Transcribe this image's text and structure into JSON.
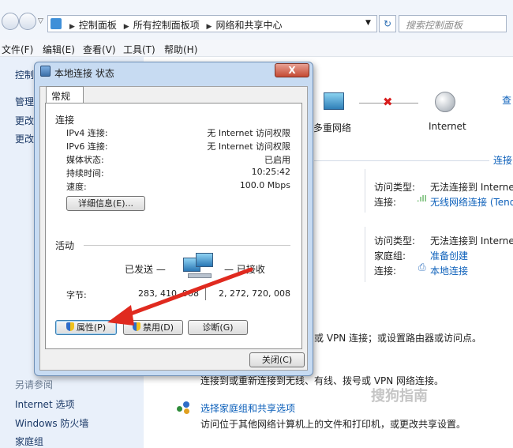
{
  "address": {
    "crumbs": [
      "控制面板",
      "所有控制面板项",
      "网络和共享中心"
    ],
    "search_placeholder": "搜索控制面板"
  },
  "menu": [
    "文件(F)",
    "编辑(E)",
    "查看(V)",
    "工具(T)",
    "帮助(H)"
  ],
  "leftpane": {
    "top_items": [
      "控制",
      "管理",
      "更改",
      "更改"
    ],
    "see_also": "另请参阅",
    "items": [
      "Internet 选项",
      "Windows 防火墙",
      "家庭组"
    ]
  },
  "map": {
    "node_multi": "多重网络",
    "node_internet": "Internet",
    "view_full": "查",
    "connect_link": "连接"
  },
  "networks": [
    {
      "access_label": "访问类型:",
      "access_value": "无法连接到 Internet",
      "conn_label": "连接:",
      "conn_value": "无线网络连接 (Tenda"
    },
    {
      "access_label": "访问类型:",
      "access_value": "无法连接到 Internet",
      "home_label": "家庭组:",
      "home_value": "准备创建",
      "conn_label": "连接:",
      "conn_value": "本地连接"
    }
  ],
  "tasks": {
    "setup_tail": "或 VPN 连接；或设置路由器或访问点。",
    "connect_desc": "连接到或重新连接到无线、有线、拨号或 VPN 网络连接。",
    "homegroup_link": "选择家庭组和共享选项",
    "homegroup_desc": "访问位于其他网络计算机上的文件和打印机，或更改共享设置。"
  },
  "dialog": {
    "title": "本地连接 状态",
    "close_glyph": "X",
    "tab": "常规",
    "connection_section": "连接",
    "rows": [
      {
        "label": "IPv4 连接:",
        "value": "无 Internet 访问权限"
      },
      {
        "label": "IPv6 连接:",
        "value": "无 Internet 访问权限"
      },
      {
        "label": "媒体状态:",
        "value": "已启用"
      },
      {
        "label": "持续时间:",
        "value": "10:25:42"
      },
      {
        "label": "速度:",
        "value": "100.0 Mbps"
      }
    ],
    "details_button": "详细信息(E)...",
    "activity_section": "活动",
    "sent_label": "已发送 —",
    "received_label": "— 已接收",
    "bytes_label": "字节:",
    "bytes_sent": "283, 410, 908",
    "bytes_received": "2, 272, 720, 008",
    "properties_button": "属性(P)",
    "disable_button": "禁用(D)",
    "diagnose_button": "诊断(G)",
    "close_button": "关闭(C)"
  },
  "watermark": "搜狗指南",
  "colors": {
    "link": "#0b5fba",
    "arrow": "#e02a1f",
    "dialog_frame": "#c7dbf2"
  }
}
